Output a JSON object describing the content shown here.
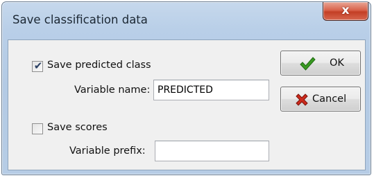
{
  "dialog": {
    "title": "Save classification data",
    "close_label": "x"
  },
  "save_predicted": {
    "label": "Save predicted class",
    "checked": true,
    "variable_name_label": "Variable name:",
    "variable_name_value": "PREDICTED"
  },
  "save_scores": {
    "label": "Save scores",
    "checked": false,
    "variable_prefix_label": "Variable prefix:",
    "variable_prefix_value": ""
  },
  "buttons": {
    "ok_label": "OK",
    "cancel_label": "Cancel"
  },
  "icons": {
    "ok_icon": "green-check-icon",
    "cancel_icon": "red-x-icon",
    "check_color": "#2f8a1e",
    "cancel_color": "#c0281c"
  }
}
